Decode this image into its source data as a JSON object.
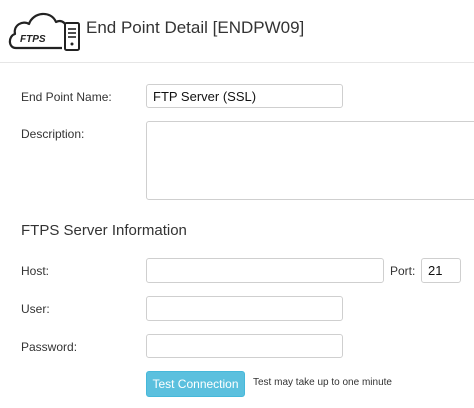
{
  "header": {
    "title": "End Point Detail [ENDPW09]",
    "logo_text": "FTPS"
  },
  "form": {
    "endpoint_name": {
      "label": "End Point Name:",
      "value": "FTP Server (SSL)"
    },
    "description": {
      "label": "Description:",
      "value": ""
    }
  },
  "server": {
    "section_title": "FTPS Server Information",
    "host": {
      "label": "Host:",
      "value": ""
    },
    "port": {
      "label": "Port:",
      "value": "21"
    },
    "user": {
      "label": "User:",
      "value": ""
    },
    "password": {
      "label": "Password:",
      "value": ""
    }
  },
  "actions": {
    "test_label": "Test Connection",
    "test_hint": "Test may take up to one minute"
  },
  "colors": {
    "button": "#5bc0de",
    "border": "#cfcfcf"
  }
}
